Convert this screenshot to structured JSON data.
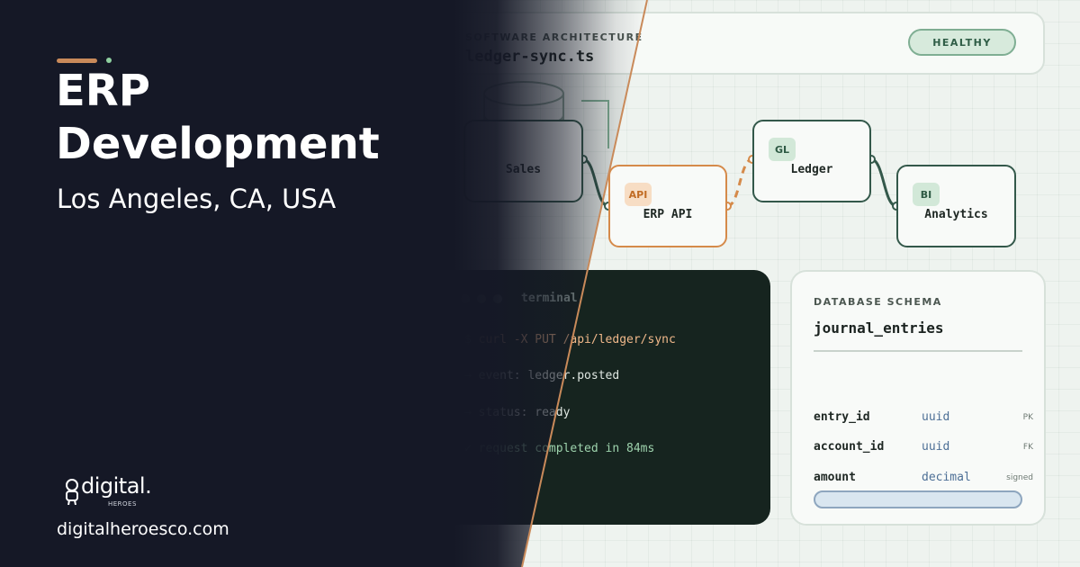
{
  "hero": {
    "title_line1": "ERP",
    "title_line2": "Development",
    "location": "Los Angeles, CA, USA",
    "website": "digitalheroesco.com"
  },
  "logo": {
    "wordmark": "digital.",
    "subtext": "HEROES"
  },
  "header": {
    "eyebrow": "SOFTWARE ARCHITECTURE",
    "filename": "ledger-sync.ts",
    "status": "HEALTHY"
  },
  "nodes": {
    "sales": {
      "label": "Sales"
    },
    "api": {
      "badge": "API",
      "label": "ERP API"
    },
    "ledger": {
      "badge": "GL",
      "label": "Ledger"
    },
    "analytics": {
      "badge": "BI",
      "label": "Analytics"
    }
  },
  "terminal": {
    "title": "terminal",
    "lines": [
      {
        "prefix": "$ ",
        "text": "curl -X PUT /api/ledger/sync"
      },
      {
        "prefix": "→ ",
        "text": "event: ledger.posted"
      },
      {
        "prefix": "→ ",
        "text": "status: ready"
      },
      {
        "prefix": "✓ ",
        "text": "request completed in 84ms"
      }
    ]
  },
  "schema": {
    "eyebrow": "DATABASE SCHEMA",
    "table": "journal_entries",
    "rows": [
      {
        "column": "entry_id",
        "type": "uuid",
        "key": "PK"
      },
      {
        "column": "account_id",
        "type": "uuid",
        "key": "FK"
      },
      {
        "column": "amount",
        "type": "decimal",
        "key": "signed"
      }
    ]
  },
  "colors": {
    "dark_panel": "#151826",
    "accent_orange": "#d58a4a",
    "accent_green": "#33584a",
    "terminal_bg": "#16241f"
  }
}
